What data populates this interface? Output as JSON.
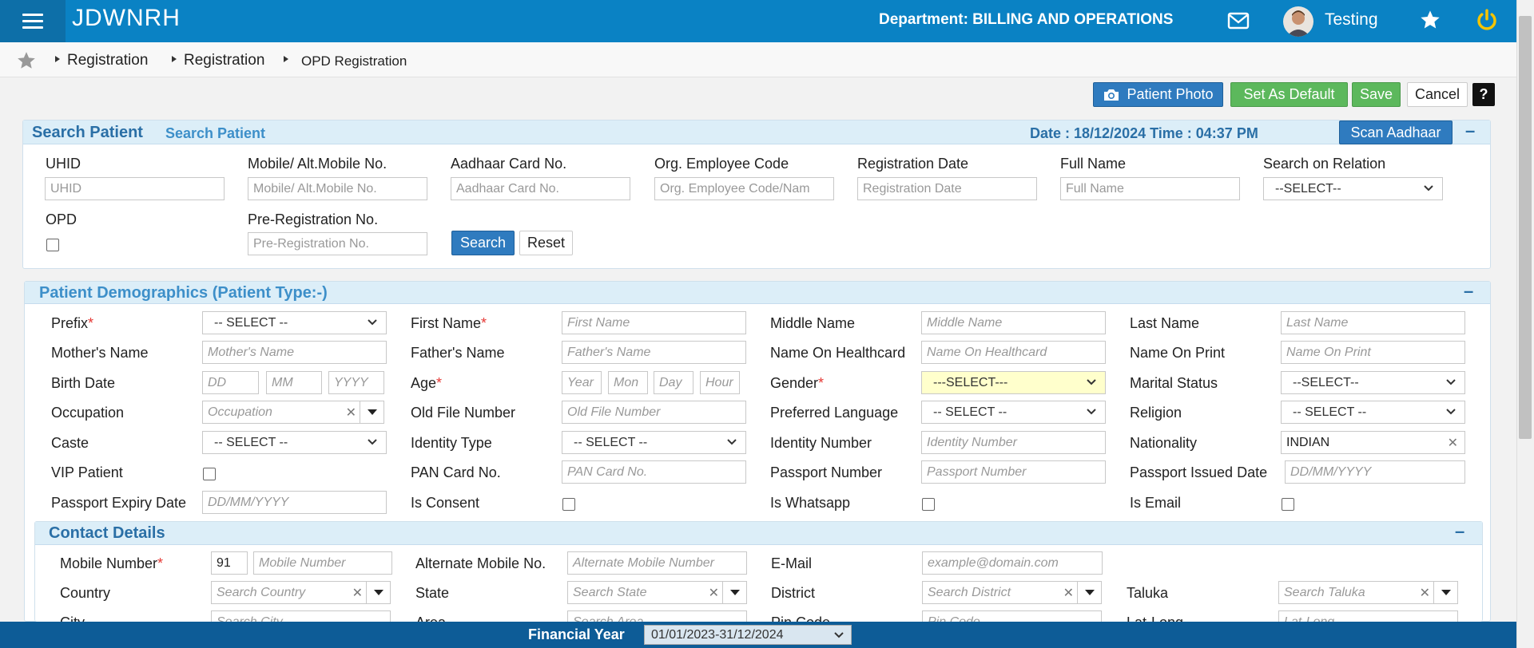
{
  "app": {
    "title": "JDWNRH",
    "department": "Department: BILLING AND OPERATIONS",
    "user": "Testing",
    "icons": [
      "menu-icon",
      "mail-icon",
      "avatar",
      "star-icon",
      "power-icon"
    ],
    "accent": "#0a82c4"
  },
  "breadcrumb": [
    "Registration",
    "Registration",
    "OPD Registration"
  ],
  "toolbar": {
    "patient_photo": "Patient Photo",
    "set_default": "Set As Default",
    "save": "Save",
    "cancel": "Cancel",
    "help": "?"
  },
  "search_panel": {
    "title": "Search Patient",
    "subtitle": "Search Patient",
    "datetime": "Date : 18/12/2024 Time : 04:37 PM",
    "scan_aadhaar": "Scan Aadhaar",
    "collapse": "–",
    "fields": {
      "uhid": {
        "label": "UHID",
        "placeholder": "UHID"
      },
      "mobile": {
        "label": "Mobile/ Alt.Mobile No.",
        "placeholder": "Mobile/ Alt.Mobile No."
      },
      "aadhaar": {
        "label": "Aadhaar Card No.",
        "placeholder": "Aadhaar Card No."
      },
      "org_emp": {
        "label": "Org. Employee Code",
        "placeholder": "Org. Employee Code/Nam"
      },
      "reg_date": {
        "label": "Registration Date",
        "placeholder": "Registration Date"
      },
      "full_name": {
        "label": "Full Name",
        "placeholder": "Full Name"
      },
      "relation": {
        "label": "Search on Relation",
        "value": "--SELECT--"
      },
      "opd": {
        "label": "OPD"
      },
      "pre_reg": {
        "label": "Pre-Registration No.",
        "placeholder": "Pre-Registration No."
      }
    },
    "search_btn": "Search",
    "reset_btn": "Reset"
  },
  "demographics": {
    "title": "Patient Demographics (Patient Type:-)",
    "collapse": "–",
    "prefix": {
      "label": "Prefix",
      "value": "-- SELECT --"
    },
    "first_name": {
      "label": "First Name",
      "placeholder": "First Name"
    },
    "middle_name": {
      "label": "Middle Name",
      "placeholder": "Middle Name"
    },
    "last_name": {
      "label": "Last Name",
      "placeholder": "Last Name"
    },
    "mother_name": {
      "label": "Mother's Name",
      "placeholder": "Mother's Name"
    },
    "father_name": {
      "label": "Father's Name",
      "placeholder": "Father's Name"
    },
    "name_healthcard": {
      "label": "Name On Healthcard",
      "placeholder": "Name On Healthcard"
    },
    "name_print": {
      "label": "Name On Print",
      "placeholder": "Name On Print"
    },
    "birth_date": {
      "label": "Birth Date",
      "dd": "DD",
      "mm": "MM",
      "yyyy": "YYYY"
    },
    "age": {
      "label": "Age",
      "year": "Year",
      "month": "Mon",
      "day": "Day",
      "hour": "Hour"
    },
    "gender": {
      "label": "Gender",
      "value": "---SELECT---"
    },
    "marital_status": {
      "label": "Marital Status",
      "value": "--SELECT--"
    },
    "occupation": {
      "label": "Occupation",
      "placeholder": "Occupation"
    },
    "old_file": {
      "label": "Old File Number",
      "placeholder": "Old File Number"
    },
    "pref_language": {
      "label": "Preferred Language",
      "value": "-- SELECT --"
    },
    "religion": {
      "label": "Religion",
      "value": "-- SELECT --"
    },
    "caste": {
      "label": "Caste",
      "value": "-- SELECT --"
    },
    "identity_type": {
      "label": "Identity Type",
      "value": "-- SELECT --"
    },
    "identity_number": {
      "label": "Identity Number",
      "placeholder": "Identity Number"
    },
    "nationality": {
      "label": "Nationality",
      "value": "INDIAN"
    },
    "vip": {
      "label": "VIP Patient"
    },
    "pan": {
      "label": "PAN Card No.",
      "placeholder": "PAN Card No."
    },
    "passport_no": {
      "label": "Passport Number",
      "placeholder": "Passport Number"
    },
    "passport_issued": {
      "label": "Passport Issued Date",
      "placeholder": "DD/MM/YYYY"
    },
    "passport_expiry": {
      "label": "Passport Expiry Date",
      "placeholder": "DD/MM/YYYY"
    },
    "is_consent": {
      "label": "Is Consent"
    },
    "is_whatsapp": {
      "label": "Is Whatsapp"
    },
    "is_email": {
      "label": "Is Email"
    }
  },
  "contact": {
    "title": "Contact Details",
    "collapse": "–",
    "mobile": {
      "label": "Mobile Number",
      "code": "91",
      "placeholder": "Mobile Number"
    },
    "alt_mobile": {
      "label": "Alternate Mobile No.",
      "placeholder": "Alternate Mobile Number"
    },
    "email": {
      "label": "E-Mail",
      "placeholder": "example@domain.com"
    },
    "country": {
      "label": "Country",
      "placeholder": "Search Country"
    },
    "state": {
      "label": "State",
      "placeholder": "Search State"
    },
    "district": {
      "label": "District",
      "placeholder": "Search District"
    },
    "taluka": {
      "label": "Taluka",
      "placeholder": "Search Taluka"
    },
    "city": {
      "label": "City",
      "placeholder": "Search City"
    },
    "area": {
      "label": "Area",
      "placeholder": "Search Area"
    },
    "pin": {
      "label": "Pin Code",
      "placeholder": "Pin Code"
    },
    "latlong": {
      "label": "Lat-Long",
      "placeholder": "Lat-Long"
    }
  },
  "footer": {
    "fy_label": "Financial Year",
    "fy_value": "01/01/2023-31/12/2024"
  }
}
